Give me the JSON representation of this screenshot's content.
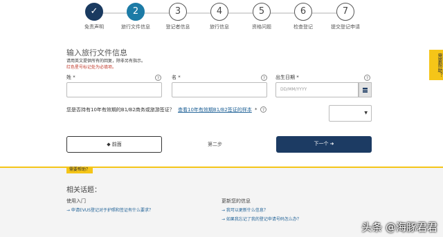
{
  "steps": [
    {
      "num": "✓",
      "label": "免责声明",
      "state": "done"
    },
    {
      "num": "2",
      "label": "旅行文件信息",
      "state": "active"
    },
    {
      "num": "3",
      "label": "登记者信息",
      "state": "todo"
    },
    {
      "num": "4",
      "label": "旅行信息",
      "state": "todo"
    },
    {
      "num": "5",
      "label": "资格问题",
      "state": "todo"
    },
    {
      "num": "6",
      "label": "检查登记",
      "state": "todo"
    },
    {
      "num": "7",
      "label": "提交登记申请",
      "state": "todo"
    }
  ],
  "form": {
    "title": "输入旅行文件信息",
    "note_line1": "请用英文提供所有的回复，除非另有指示。",
    "note_line2": "红色星号标记处为必填项。",
    "surname_label": "姓 *",
    "given_label": "名 *",
    "dob_label": "出生日期 *",
    "dob_placeholder": "DD/MM/YYYY",
    "visa_question": "您是否持有10年有效期的B1/B2商务或旅游签证？",
    "visa_link": "查看10年有效期B1/B2签证的样本",
    "visa_required": "*"
  },
  "nav": {
    "back_label": "◆ 前面",
    "step_indicator": "第二步",
    "next_label": "下一个 ➜"
  },
  "side_help": "需要帮助？",
  "footer": {
    "help_tab": "需要帮助？",
    "related_title": "相关话题：",
    "col1_title": "使用入门",
    "col1_link": "→ 申请EVUS登记对于护照和签证有什么要求？",
    "col2_title": "更新您的信息",
    "col2_link1": "→ 我可以更新什么信息？",
    "col2_link2": "→ 如果我忘记了我的登记申请号码怎么办？"
  },
  "watermark": "头条 @海豚君君",
  "colors": {
    "navy": "#1c3b63",
    "active_step": "#1c7ba6",
    "gold": "#f5c518"
  }
}
